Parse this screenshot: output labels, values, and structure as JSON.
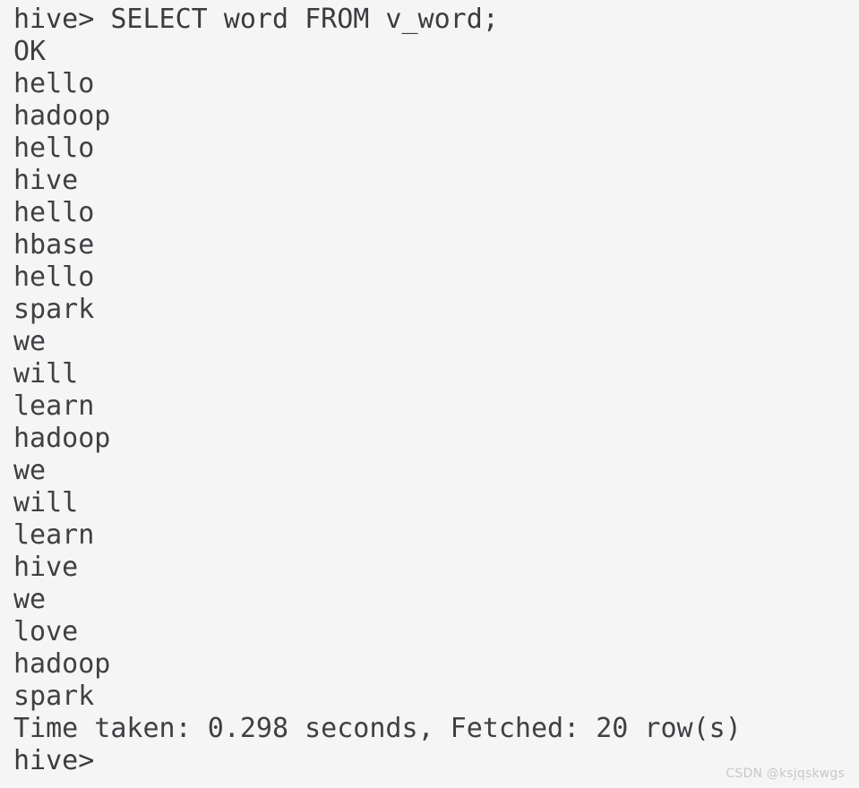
{
  "terminal": {
    "shell_name": "hive",
    "background_color": "#f5f5f5",
    "text_color": "#3f3f44",
    "lines": [
      {
        "id": "command",
        "type": "prompt",
        "text": "hive> SELECT word FROM v_word;"
      },
      {
        "id": "ok",
        "type": "status",
        "text": "OK"
      },
      {
        "id": "row-1",
        "type": "word",
        "text": "hello"
      },
      {
        "id": "row-2",
        "type": "word",
        "text": "hadoop"
      },
      {
        "id": "row-3",
        "type": "word",
        "text": "hello"
      },
      {
        "id": "row-4",
        "type": "word",
        "text": "hive"
      },
      {
        "id": "row-5",
        "type": "word",
        "text": "hello"
      },
      {
        "id": "row-6",
        "type": "word",
        "text": "hbase"
      },
      {
        "id": "row-7",
        "type": "word",
        "text": "hello"
      },
      {
        "id": "row-8",
        "type": "word",
        "text": "spark"
      },
      {
        "id": "row-9",
        "type": "word",
        "text": "we"
      },
      {
        "id": "row-10",
        "type": "word",
        "text": "will"
      },
      {
        "id": "row-11",
        "type": "word",
        "text": "learn"
      },
      {
        "id": "row-12",
        "type": "word",
        "text": "hadoop"
      },
      {
        "id": "row-13",
        "type": "word",
        "text": "we"
      },
      {
        "id": "row-14",
        "type": "word",
        "text": "will"
      },
      {
        "id": "row-15",
        "type": "word",
        "text": "learn"
      },
      {
        "id": "row-16",
        "type": "word",
        "text": "hive"
      },
      {
        "id": "row-17",
        "type": "word",
        "text": "we"
      },
      {
        "id": "row-18",
        "type": "word",
        "text": "love"
      },
      {
        "id": "row-19",
        "type": "word",
        "text": "hadoop"
      },
      {
        "id": "row-20",
        "type": "word",
        "text": "spark"
      },
      {
        "id": "summary",
        "type": "status",
        "text": "Time taken: 0.298 seconds, Fetched: 20 row(s)"
      },
      {
        "id": "prompt-waiting",
        "type": "prompt",
        "text": "hive>"
      }
    ],
    "query": "SELECT word FROM v_word;",
    "result_status": "OK",
    "time_taken_seconds": "0.298",
    "fetched_rows": "20"
  },
  "watermark": {
    "text": "CSDN @ksjqskwgs"
  }
}
